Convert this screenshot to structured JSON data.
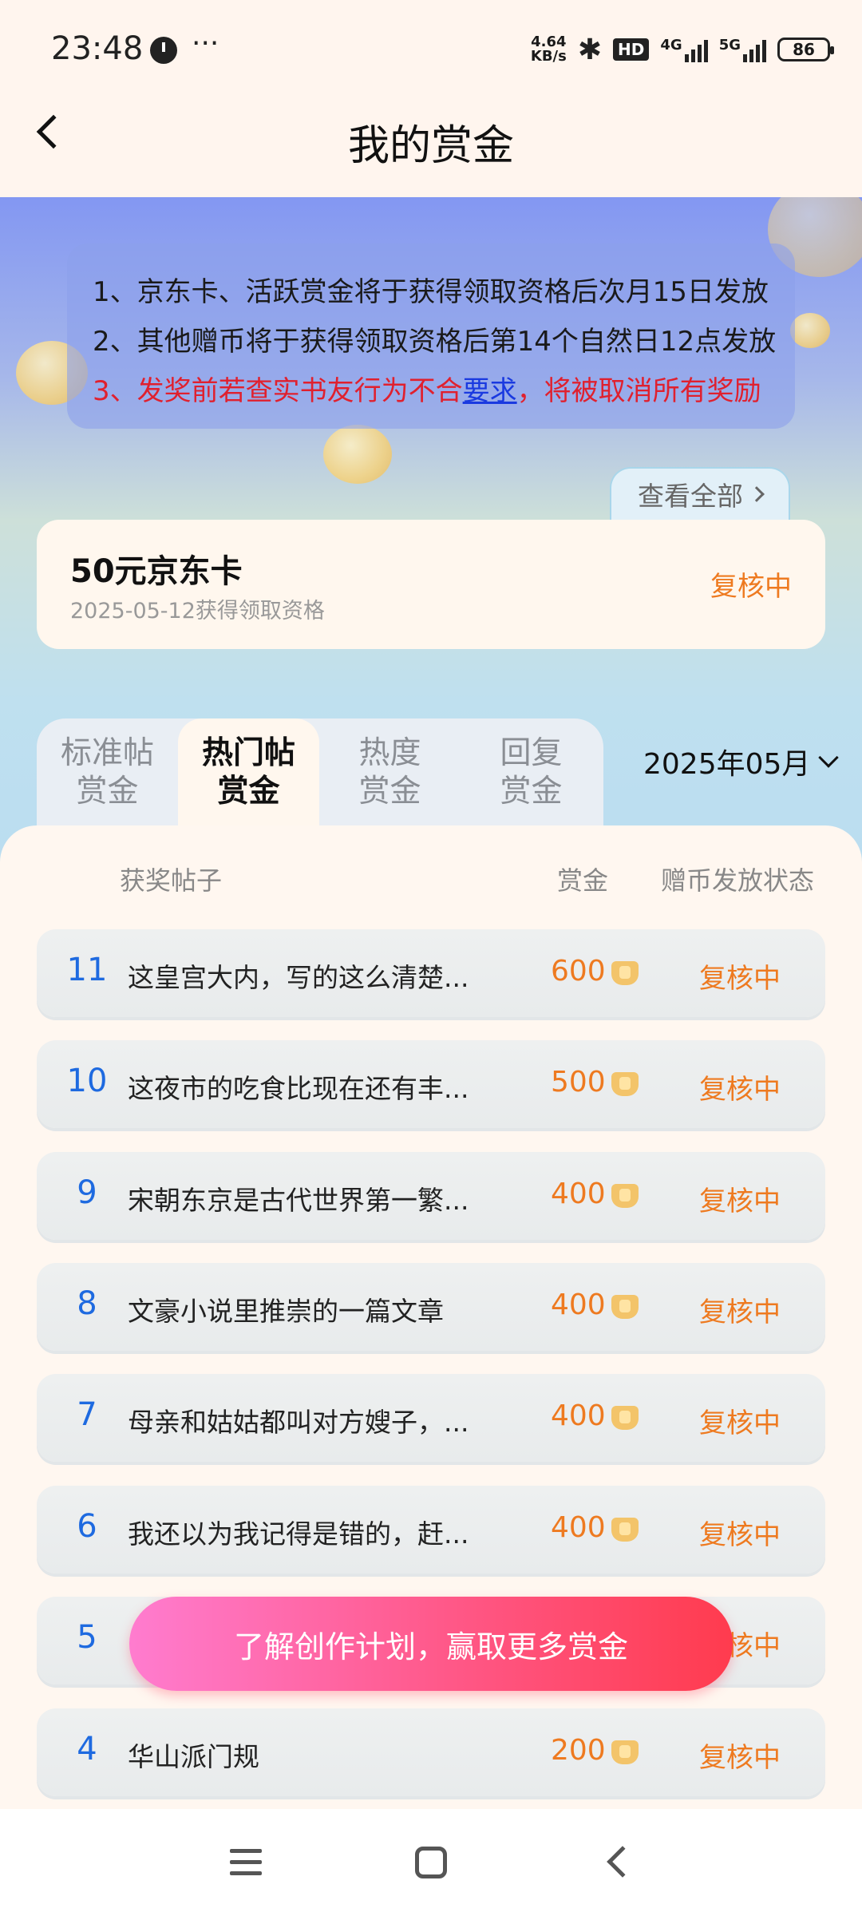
{
  "status_bar": {
    "time": "23:48",
    "more": "···",
    "net_speed_value": "4.64",
    "net_speed_unit": "KB/s",
    "hd": "HD",
    "signal1": "4G",
    "signal2": "5G",
    "battery": "86"
  },
  "header": {
    "title": "我的赏金"
  },
  "rules": {
    "line1": "1、京东卡、活跃赏金将于获得领取资格后次月15日发放",
    "line2": "2、其他赠币将于获得领取资格后第14个自然日12点发放",
    "line3_prefix": "3、发奖前若查实书友行为不合",
    "line3_link": "要求",
    "line3_suffix": "，将被取消所有奖励"
  },
  "view_all": {
    "label": "查看全部"
  },
  "jd_card": {
    "title": "50元京东卡",
    "date": "2025-05-12获得领取资格",
    "status": "复核中"
  },
  "tabs": [
    {
      "line1": "标准帖",
      "line2": "赏金"
    },
    {
      "line1": "热门帖",
      "line2": "赏金",
      "active": true
    },
    {
      "line1": "热度",
      "line2": "赏金"
    },
    {
      "line1": "回复",
      "line2": "赏金"
    }
  ],
  "month": "2025年05月",
  "table": {
    "headers": {
      "post": "获奖帖子",
      "amount": "赏金",
      "status": "赠币发放状态"
    },
    "rows": [
      {
        "rank": "11",
        "title": "这皇宫大内，写的这么清楚...",
        "amount": "600",
        "status": "复核中"
      },
      {
        "rank": "10",
        "title": "这夜市的吃食比现在还有丰...",
        "amount": "500",
        "status": "复核中"
      },
      {
        "rank": "9",
        "title": "宋朝东京是古代世界第一繁...",
        "amount": "400",
        "status": "复核中"
      },
      {
        "rank": "8",
        "title": "文豪小说里推崇的一篇文章",
        "amount": "400",
        "status": "复核中"
      },
      {
        "rank": "7",
        "title": "母亲和姑姑都叫对方嫂子，...",
        "amount": "400",
        "status": "复核中"
      },
      {
        "rank": "6",
        "title": "我还以为我记得是错的，赶...",
        "amount": "400",
        "status": "复核中"
      },
      {
        "rank": "5",
        "title": "",
        "amount": "",
        "status": "复核中"
      },
      {
        "rank": "4",
        "title": "华山派门规",
        "amount": "200",
        "status": "复核中"
      }
    ]
  },
  "cta": {
    "label": "了解创作计划，赢取更多赏金"
  },
  "colors": {
    "accent_orange": "#ee7a20",
    "rank_blue": "#1e6ae0",
    "warning_red": "#e0202e"
  }
}
